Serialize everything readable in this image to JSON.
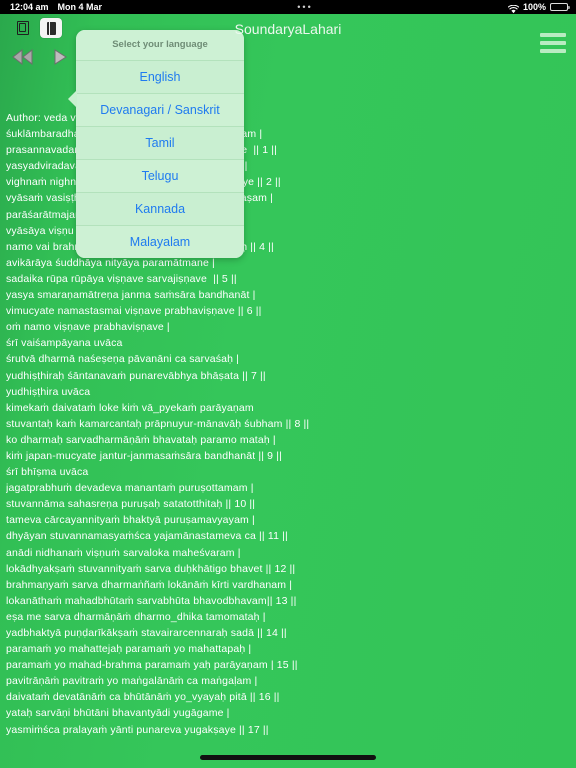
{
  "statusbar": {
    "time": "12:04 am",
    "date": "Mon 4 Mar",
    "center_dots": "•••",
    "wifi_icon": "wifi-icon",
    "battery_percent": "100%",
    "battery_icon": "battery-full-icon"
  },
  "toolbar": {
    "title": "SoundaryaLahari",
    "icon_document": "document-copy-icon",
    "icon_book": "book-page-icon",
    "menu_icon": "hamburger-menu-icon",
    "prev_icon": "rewind-icon",
    "play_icon": "play-icon"
  },
  "popup": {
    "header": "Select your language",
    "items": [
      {
        "label": "English"
      },
      {
        "label": "Devanagari / Sanskrit"
      },
      {
        "label": "Tamil"
      },
      {
        "label": "Telugu"
      },
      {
        "label": "Kannada"
      },
      {
        "label": "Malayalam"
      }
    ]
  },
  "content": {
    "lines": [
      "Author: veda vyāsa",
      "śuklāmbaradharaṁ viṣṇuṁ śaśivarṇaṁ caturbhujam |",
      "prasannavadanaṁ dhyāyet sarvavighnopaśāntaye  || 1 ||",
      "yasyadviradavaktrādyāḥ pāriṣadyāḥ paraḥ śatam |",
      "vighnaṁ nighnanti satataṁ viṣvaksenaṁ tamāśraye || 2 ||",
      "vyāsaṁ vasiṣṭha naptāraṁ śakteḥ pautramakalmaṣam |",
      "parāśarātmajaṁ vande śukatātaṁ taponidhim ||",
      "vyāsāya viṣṇu rūpāya vyāsarūpāya viṣṇave |",
      "namo vai brahmanidhaye vāsiṣṭhāya namo namaḥ || 4 ||",
      "avikārāya śuddhāya nityāya paramātmane |",
      "sadaika rūpa rūpāya viṣṇave sarvajiṣṇave  || 5 ||",
      "yasya smaraṇamātreṇa janma saṁsāra bandhanāt |",
      "vimucyate namastasmai viṣṇave prabhaviṣṇave || 6 ||",
      "oṁ namo viṣṇave prabhaviṣṇave |",
      "śrī vaiśampāyana uvāca",
      "śrutvā dharmā naśeṣeṇa pāvanāni ca sarvaśaḥ |",
      "yudhiṣṭhiraḥ śāntanavaṁ punarevābhya bhāṣata || 7 ||",
      "yudhiṣṭhira uvāca",
      "kimekaṁ daivataṁ loke kiṁ vā_pyekaṁ parāyaṇam",
      "stuvantaḥ kaṁ kamarcantaḥ prāpnuyur-mānavāḥ śubham || 8 ||",
      "ko dharmaḥ sarvadharmāṇāṁ bhavataḥ paramo mataḥ |",
      "kiṁ japan-mucyate jantur-janmasaṁsāra bandhanāt || 9 ||",
      "śrī bhīṣma uvāca",
      "jagatprabhuṁ devadeva manantaṁ puruṣottamam |",
      "stuvannāma sahasreṇa puruṣaḥ satatotthitaḥ || 10 ||",
      "tameva cārcayannityaṁ bhaktyā puruṣamavyayam |",
      "dhyāyan stuvannamasyaṁśca yajamānastameva ca || 11 ||",
      "anādi nidhanaṁ viṣṇuṁ sarvaloka maheśvaram |",
      "lokādhyakṣaṁ stuvannityaṁ sarva duḥkhātigo bhavet || 12 ||",
      "brahmaṇyaṁ sarva dharmaṅñaṁ lokānāṁ kīrti vardhanam |",
      "lokanāthaṁ mahadbhūtaṁ sarvabhūta bhavodbhavam|| 13 ||",
      "eṣa me sarva dharmāṇāṁ dharmo_dhika tamomataḥ |",
      "yadbhaktyā puṇḍarīkākṣaṁ stavairarcennaraḥ sadā || 14 ||",
      "paramaṁ yo mahattejaḥ paramaṁ yo mahattapaḥ |",
      "paramaṁ yo mahad-brahma paramaṁ yaḥ parāyaṇam | 15 ||",
      "pavitrāṇāṁ pavitraṁ yo maṅgalānāṁ ca maṅgaḷam |",
      "daivataṁ devatānāṁ ca bhūtānāṁ yo_vyayaḥ pitā || 16 ||",
      "yataḥ sarvāṇi bhūtāni bhavantyādi yugāgame |",
      "yasmiṁśca pralayaṁ yānti punareva yugakṣaye || 17 ||"
    ]
  },
  "colors": {
    "background_green": "#33c457",
    "popup_bg": "#cdf1d4",
    "link_blue": "#1f7bf0",
    "text_white": "#ffffff",
    "statusbar_bg": "#000000"
  }
}
